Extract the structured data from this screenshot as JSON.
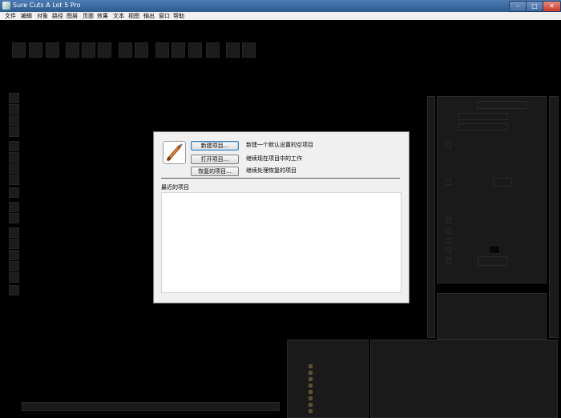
{
  "window": {
    "title": "Sure Cuts A Lot 5 Pro",
    "controls": [
      "–",
      "□",
      "✕"
    ]
  },
  "menu": [
    "文件",
    "编辑",
    "对象",
    "路径",
    "图层",
    "页面",
    "效果",
    "文本",
    "视图",
    "输出",
    "窗口",
    "帮助"
  ],
  "dialog": {
    "icon": "cutting-blade-icon",
    "buttons": [
      {
        "label": "新建项目...",
        "description": "新建一个默认设置的空项目"
      },
      {
        "label": "打开项目...",
        "description": "继续现在项目中的工作"
      },
      {
        "label": "恢复的项目...",
        "description": "继续处理恢复的项目"
      }
    ],
    "recent_label": "最近的项目",
    "recent_items": []
  },
  "colors": {
    "background": "#000000",
    "dialog_bg": "#f0f0f0",
    "titlebar": "#3a6aa3",
    "close_button": "#c8402f"
  }
}
